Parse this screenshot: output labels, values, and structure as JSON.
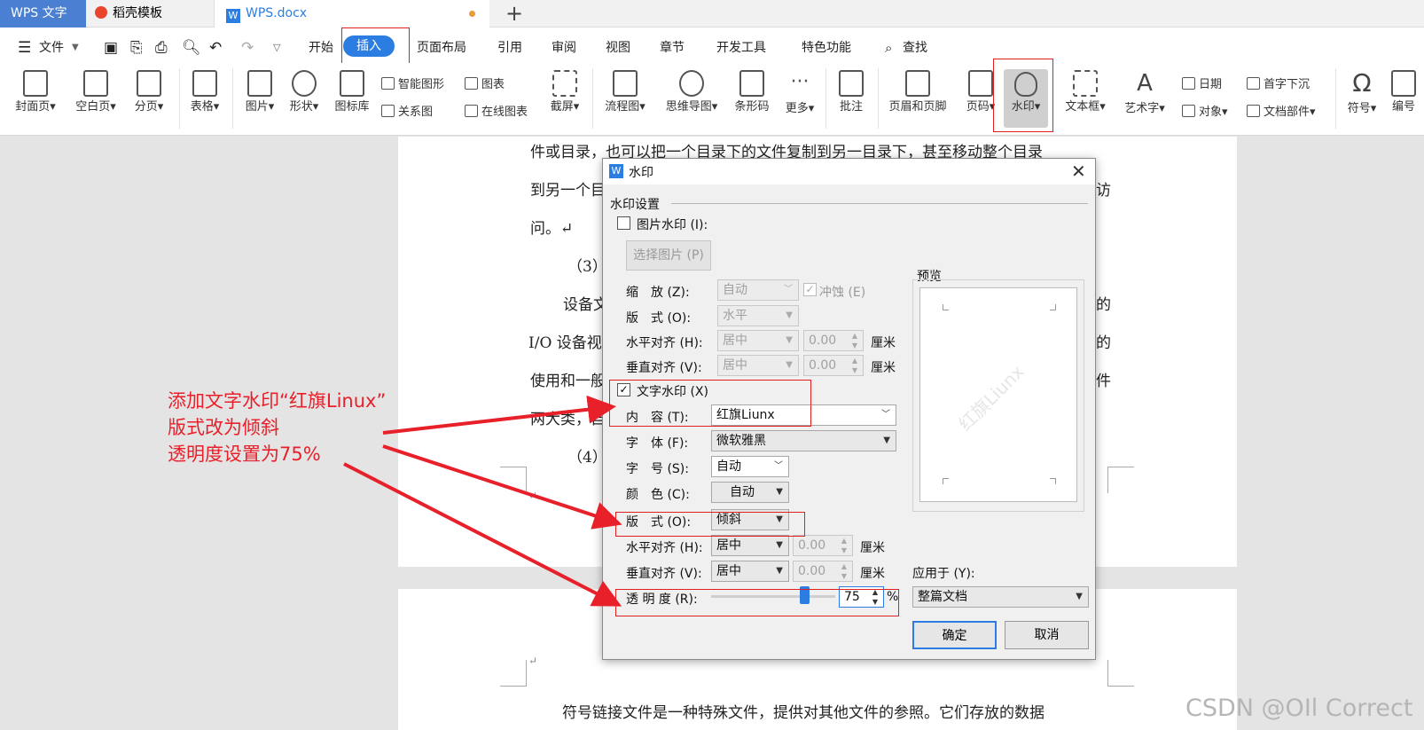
{
  "tabs": {
    "app": "WPS 文字",
    "template": "稻壳模板",
    "doc": "WPS.docx",
    "add": "+"
  },
  "menu": {
    "hamburger": "☰",
    "file": "文件",
    "items": [
      "开始",
      "插入",
      "页面布局",
      "引用",
      "审阅",
      "视图",
      "章节",
      "开发工具",
      "特色功能"
    ],
    "search": "查找"
  },
  "toolbar": {
    "cover": "封面页",
    "blank": "空白页",
    "break": "分页",
    "table": "表格",
    "picture": "图片",
    "shape": "形状",
    "iconlib": "图标库",
    "smart": "智能图形",
    "chart": "图表",
    "relation": "关系图",
    "online_chart": "在线图表",
    "screenshot": "截屏",
    "flow": "流程图",
    "mind": "思维导图",
    "barcode": "条形码",
    "more": "更多",
    "comment": "批注",
    "header_footer": "页眉和页脚",
    "pageno": "页码",
    "watermark": "水印",
    "textbox": "文本框",
    "wordart": "艺术字",
    "date": "日期",
    "object": "对象",
    "dropcap": "首字下沉",
    "docpart": "文档部件",
    "symbol": "符号",
    "numbering": "编号"
  },
  "document": {
    "line1": "件或目录，也可以把一个目录下的文件复制到另一目录下，甚至移动整个目录",
    "line2a": "到另一个目",
    "line2b": "访",
    "line3": "问。↵",
    "line4": "（3）",
    "line5a": "设备文",
    "line5b": "的",
    "line6a": "I/O 设备视",
    "line6b": "的",
    "line7a": "使用和一般",
    "line7b": "件",
    "line8": "两大类，自",
    "line9": "（4）",
    "mark1": "↵",
    "mark2": "↵",
    "page2_line": "符号链接文件是一种特殊文件，提供对其他文件的参照。它们存放的数据"
  },
  "dialog": {
    "title": "水印",
    "section": "水印设置",
    "pic_wm": "图片水印 (I):",
    "choose_pic": "选择图片 (P)",
    "scale_label": "缩　放 (Z):",
    "scale_value": "自动",
    "erode": "冲蚀 (E)",
    "layout_label": "版　式 (O):",
    "pic_layout_value": "水平",
    "h_align_label": "水平对齐 (H):",
    "h_align_value": "居中",
    "h_offset": "0.00",
    "v_align_label": "垂直对齐 (V):",
    "v_align_value": "居中",
    "v_offset": "0.00",
    "unit": "厘米",
    "text_wm": "文字水印 (X)",
    "content_label": "内　容 (T):",
    "content_value": "红旗Liunx",
    "font_label": "字　体 (F):",
    "font_value": "微软雅黑",
    "size_label": "字　号 (S):",
    "size_value": "自动",
    "color_label": "颜　色 (C):",
    "color_value": "自动",
    "text_layout_label": "版　式 (O):",
    "text_layout_value": "倾斜",
    "opacity_label": "透 明 度 (R):",
    "opacity_value": "75",
    "opacity_level": 0.75,
    "percent": "%",
    "preview_label": "预览",
    "preview_text": "红旗Liunx",
    "apply_label": "应用于 (Y):",
    "apply_value": "整篇文档",
    "ok": "确定",
    "cancel": "取消"
  },
  "annotation": {
    "line1": "添加文字水印“红旗Linux”",
    "line2": "版式改为倾斜",
    "line3": "透明度设置为75%"
  },
  "credit": "CSDN @OIl Correct",
  "colors": {
    "annotation_red": "#e8202a",
    "insert_tab": "#2b7de1",
    "wps_blue": "#2b7de1"
  }
}
